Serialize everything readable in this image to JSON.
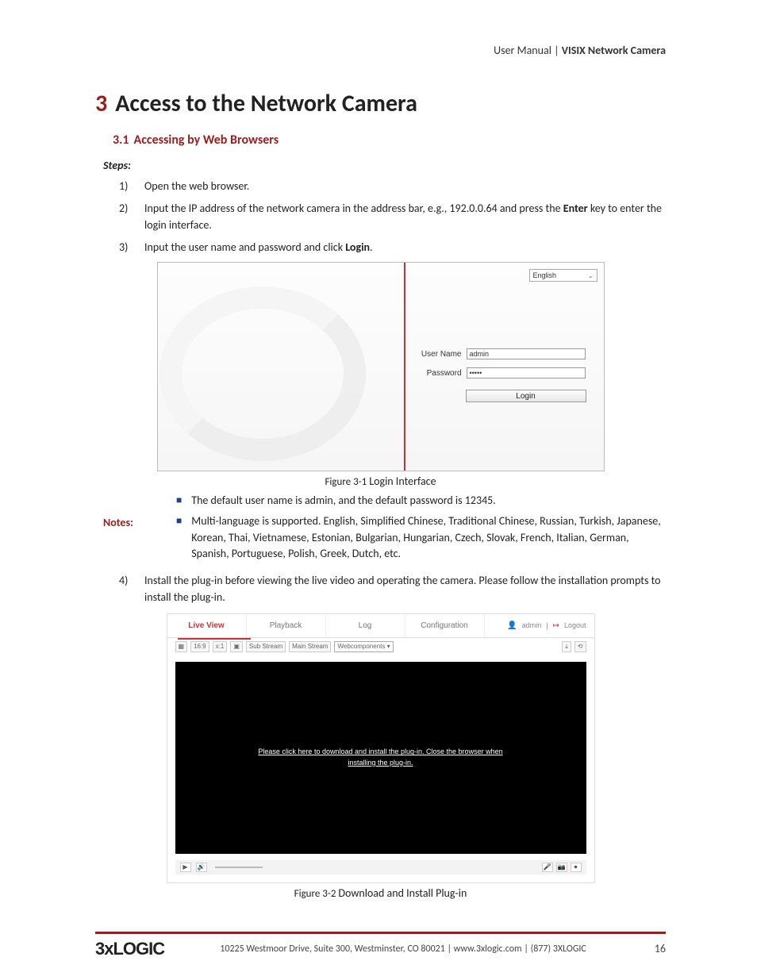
{
  "header": {
    "left": "User Manual",
    "sep": " | ",
    "right": "VISIX Network Camera"
  },
  "chapter": {
    "number": "3",
    "title": "Access to the Network Camera"
  },
  "section": {
    "number": "3.1",
    "title": "Accessing by Web Browsers"
  },
  "steps_label": "Steps:",
  "steps": [
    {
      "n": "1)",
      "text": "Open the web browser."
    },
    {
      "n": "2)",
      "text_pre": "Input the IP address of the network camera in the address bar, e.g., 192.0.0.64 and press the ",
      "bold": "Enter",
      "text_post": " key to enter the login interface."
    },
    {
      "n": "3)",
      "text_pre": "Input the user name and password and click ",
      "bold": "Login",
      "text_post": "."
    },
    {
      "n": "4)",
      "text": "Install the plug-in before viewing the live video and operating the camera. Please follow the installation prompts to install the plug-in."
    }
  ],
  "fig1": {
    "language": "English",
    "username_label": "User Name",
    "username_value": "admin",
    "password_label": "Password",
    "password_value": "•••••",
    "login_button": "Login",
    "caption_prefix": "Figure 3-1 ",
    "caption": "Login Interface"
  },
  "notes_label": "Notes:",
  "notes": [
    "The default user name is admin, and the default password is 12345.",
    "Multi-language is supported. English, Simplified Chinese, Traditional Chinese, Russian, Turkish, Japanese, Korean, Thai, Vietnamese, Estonian, Bulgarian, Hungarian, Czech, Slovak, French, Italian, German, Spanish, Portuguese, Polish, Greek, Dutch, etc."
  ],
  "fig2": {
    "tabs": [
      "Live View",
      "Playback",
      "Log",
      "Configuration"
    ],
    "user": "admin",
    "logout": "Logout",
    "toolbar": {
      "sub": "Sub Stream",
      "main": "Main Stream",
      "dd": "Webcomponents  ▾"
    },
    "video_msg_l1": "Please click here to download and install the plug-in. Close the browser when",
    "video_msg_l2": "installing the plug-in.",
    "caption_prefix": "Figure 3-2 ",
    "caption": "Download and Install Plug-in"
  },
  "footer": {
    "logo": "3xLOGIC",
    "addr": "10225 Westmoor Drive, Suite 300, Westminster, CO 80021 | www.3xlogic.com | (877) 3XLOGIC",
    "page": "16"
  }
}
